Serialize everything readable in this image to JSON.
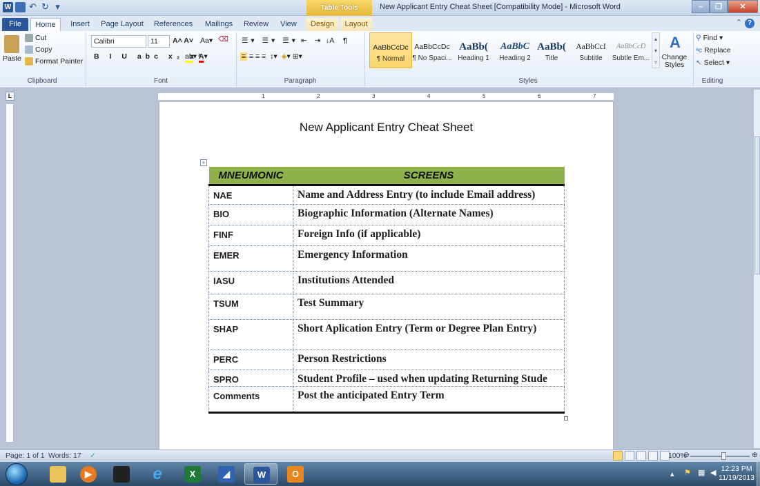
{
  "window": {
    "title": "New Applicant Entry Cheat Sheet [Compatibility Mode] - Microsoft Word",
    "context_tab_group": "Table Tools"
  },
  "tabs": [
    "File",
    "Home",
    "Insert",
    "Page Layout",
    "References",
    "Mailings",
    "Review",
    "View",
    "Design",
    "Layout"
  ],
  "ribbon": {
    "clipboard": {
      "paste": "Paste",
      "cut": "Cut",
      "copy": "Copy",
      "format_painter": "Format Painter",
      "label": "Clipboard"
    },
    "font": {
      "name": "Calibri",
      "size": "11",
      "label": "Font"
    },
    "paragraph": {
      "label": "Paragraph"
    },
    "styles": {
      "label": "Styles",
      "items": [
        {
          "preview": "AaBbCcDc",
          "name": "¶ Normal"
        },
        {
          "preview": "AaBbCcDc",
          "name": "¶ No Spaci..."
        },
        {
          "preview": "AaBb(",
          "name": "Heading 1"
        },
        {
          "preview": "AaBbC",
          "name": "Heading 2"
        },
        {
          "preview": "AaBb(",
          "name": "Title"
        },
        {
          "preview": "AaBbCcI",
          "name": "Subtitle"
        },
        {
          "preview": "AaBbCcD",
          "name": "Subtle Em..."
        }
      ],
      "change_styles": "Change Styles"
    },
    "editing": {
      "find": "Find",
      "replace": "Replace",
      "select": "Select",
      "label": "Editing"
    }
  },
  "document": {
    "title": "New Applicant Entry Cheat Sheet",
    "table": {
      "headers": [
        "MNEUMONIC",
        "SCREENS"
      ],
      "rows": [
        {
          "code": "NAE",
          "screen": "Name and Address Entry (to include Email address)"
        },
        {
          "code": "BIO",
          "screen": "Biographic Information (Alternate Names)"
        },
        {
          "code": "FINF",
          "screen": "Foreign Info (if applicable)"
        },
        {
          "code": "EMER",
          "screen": "Emergency Information"
        },
        {
          "code": "IASU",
          "screen": "Institutions Attended"
        },
        {
          "code": "TSUM",
          "screen": "Test Summary"
        },
        {
          "code": "SHAP",
          "screen": "Short Aplication Entry (Term or Degree Plan Entry)"
        },
        {
          "code": "PERC",
          "screen": "Person Restrictions"
        },
        {
          "code": "SPRO",
          "screen": "Student Profile – used when updating Returning Stude"
        },
        {
          "code": "Comments",
          "screen": "Post the anticipated Entry Term"
        }
      ]
    }
  },
  "statusbar": {
    "page": "Page: 1 of 1",
    "words": "Words: 17",
    "zoom": "100%"
  },
  "taskbar": {
    "time": "12:23 PM",
    "date": "11/19/2013"
  },
  "colors": {
    "table_header": "#8fb14b",
    "file_tab": "#2b579a",
    "context_tab": "#e7b83b"
  }
}
